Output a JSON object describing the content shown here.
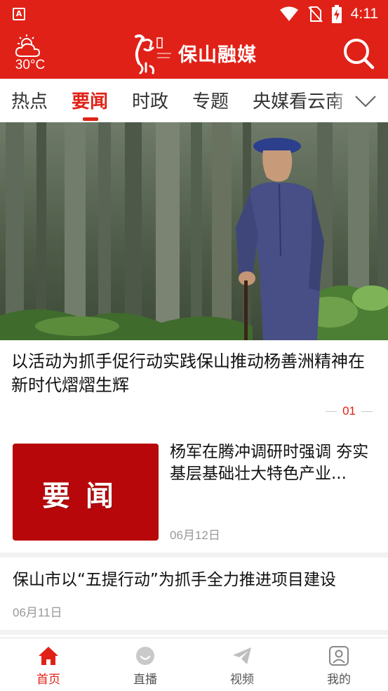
{
  "status_bar": {
    "time": "4:11",
    "icons": [
      "app-notification-icon",
      "wifi-icon",
      "no-sim-icon",
      "battery-charging-icon"
    ]
  },
  "header": {
    "temperature": "30°C",
    "weather_icon": "partly-cloudy-icon",
    "brand_name": "保山融媒",
    "logo_calligraphy": "保山",
    "search_icon": "search-icon"
  },
  "tabs": {
    "items": [
      {
        "label": "热点",
        "active": false
      },
      {
        "label": "要闻",
        "active": true
      },
      {
        "label": "时政",
        "active": false
      },
      {
        "label": "专题",
        "active": false
      },
      {
        "label": "央媒看云南",
        "active": false
      }
    ],
    "more_icon": "chevron-down-icon"
  },
  "hero": {
    "title": "以活动为抓手促行动实践保山推动杨善洲精神在新时代熠熠生辉",
    "page_number": "01"
  },
  "news": [
    {
      "thumb_text": "要闻",
      "title": "杨军在腾冲调研时强调  夯实基层基础壮大特色产业...",
      "date": "06月12日"
    },
    {
      "title": "保山市以“五提行动”为抓手全力推进项目建设",
      "date": "06月11日"
    }
  ],
  "bottom_nav": {
    "items": [
      {
        "label": "首页",
        "icon": "home-icon",
        "active": true
      },
      {
        "label": "直播",
        "icon": "live-icon",
        "active": false
      },
      {
        "label": "视频",
        "icon": "paper-plane-icon",
        "active": false
      },
      {
        "label": "我的",
        "icon": "profile-icon",
        "active": false
      }
    ]
  },
  "colors": {
    "brand_red": "#e02117",
    "thumb_red": "#b8070a",
    "date_gray": "#999999"
  }
}
